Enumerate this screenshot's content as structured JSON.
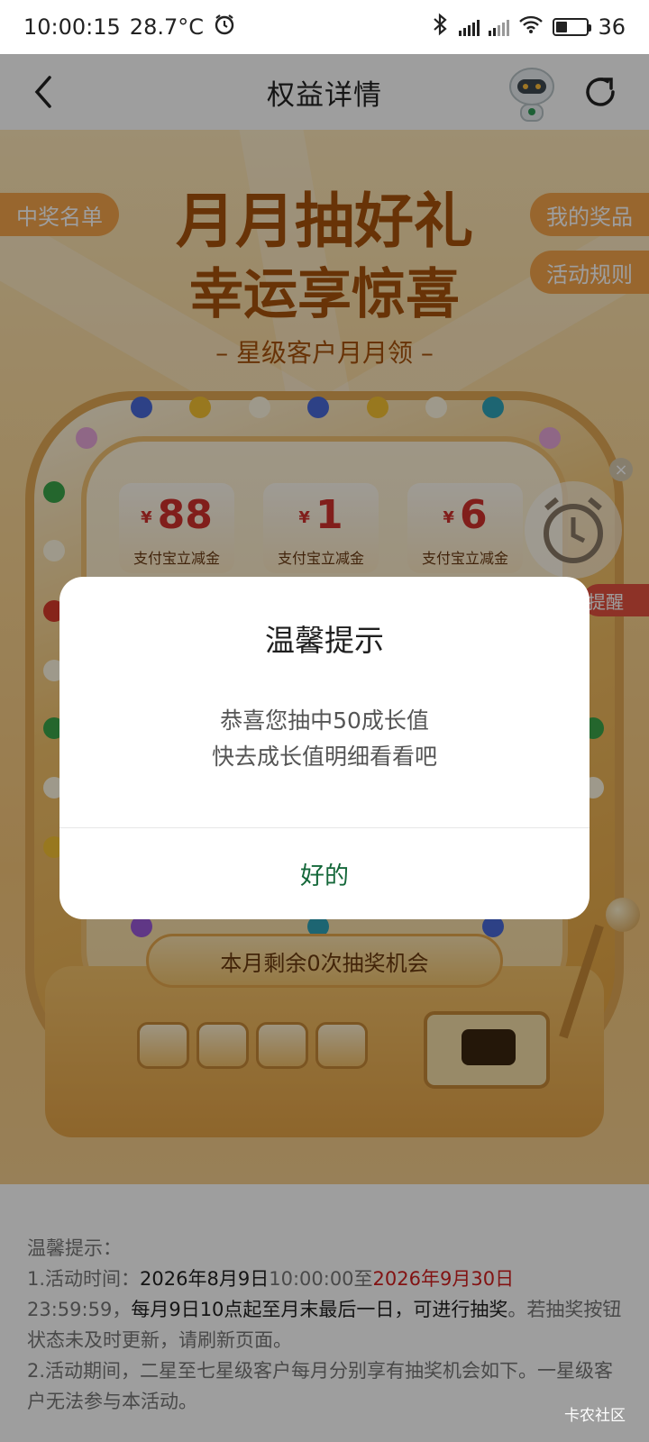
{
  "status_bar": {
    "time": "10:00:15",
    "temperature": "28.7°C",
    "battery_level": "36",
    "icons": [
      "alarm-icon",
      "bluetooth-icon",
      "signal-icon",
      "signal-icon",
      "wifi-icon",
      "battery-icon"
    ]
  },
  "nav": {
    "title": "权益详情",
    "back_icon": "chevron-left-icon",
    "assistant_icon": "robot-assistant-icon",
    "refresh_icon": "refresh-icon"
  },
  "hero": {
    "left_pill": "中奖名单",
    "right_pills": [
      "我的奖品",
      "活动规则"
    ],
    "title_line1": "月月抽好礼",
    "title_line2": "幸运享惊喜",
    "subtitle": "– 星级客户月月领 –",
    "prize_cards": [
      {
        "currency": "¥",
        "amount": "88",
        "label": "支付宝立减金"
      },
      {
        "currency": "¥",
        "amount": "1",
        "label": "支付宝立减金"
      },
      {
        "currency": "¥",
        "amount": "6",
        "label": "支付宝立减金"
      }
    ],
    "remaining": "本月剩余0次抽奖机会",
    "reminder_tag": "提醒",
    "timer_close": "×"
  },
  "notes": {
    "heading": "温馨提示：",
    "line1_prefix": "1.活动时间：",
    "line1_start_date": "2026年8月9日",
    "line1_start_time": "10:00:00",
    "line1_to": "至",
    "line1_end_date": "2026年9月30日",
    "line2_time": "23:59:59",
    "line2_comma": "，",
    "line2_rule": "每月9日10点起至月末最后一日，可进行抽奖",
    "line2_tail": "。若抽奖按钮状态未及时更新，请刷新页面。",
    "line3": "2.活动期间，二星至七星级客户每月分别享有抽奖机会如下。一星级客户无法参与本活动。"
  },
  "watermark": "卡农社区",
  "dialog": {
    "title": "温馨提示",
    "message_line1": "恭喜您抽中50成长值",
    "message_line2": "快去成长值明细看看吧",
    "ok_label": "好的"
  },
  "colors": {
    "dialog_button": "#15683a",
    "highlight_red": "#d21f1f",
    "pill_orange": "#f5a54b"
  }
}
